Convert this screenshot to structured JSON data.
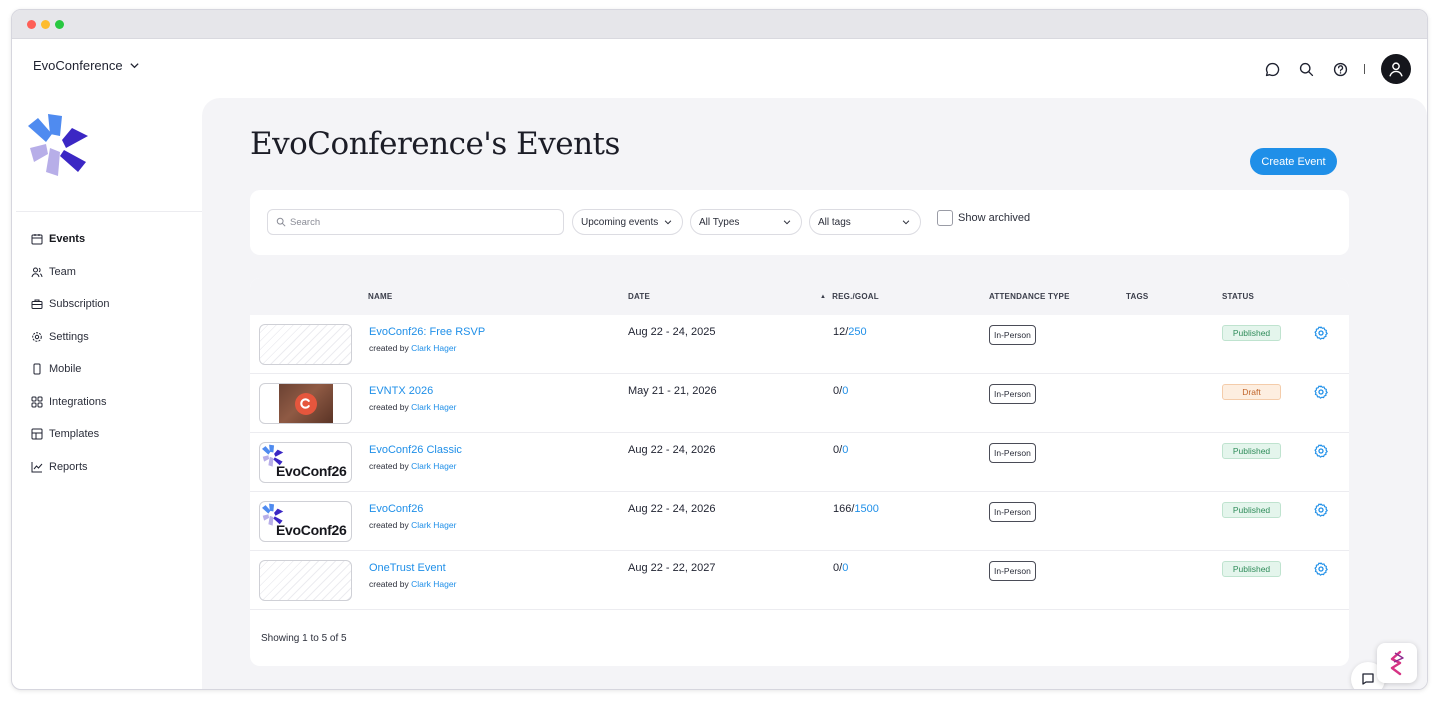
{
  "header": {
    "org_name": "EvoConference",
    "icons": [
      "chat-icon",
      "search-icon",
      "help-icon",
      "user-avatar-icon"
    ]
  },
  "sidebar": {
    "items": [
      {
        "label": "Events",
        "icon": "calendar-icon",
        "active": true
      },
      {
        "label": "Team",
        "icon": "users-icon",
        "active": false
      },
      {
        "label": "Subscription",
        "icon": "briefcase-icon",
        "active": false
      },
      {
        "label": "Settings",
        "icon": "gear-icon",
        "active": false
      },
      {
        "label": "Mobile",
        "icon": "mobile-icon",
        "active": false
      },
      {
        "label": "Integrations",
        "icon": "grid-icon",
        "active": false
      },
      {
        "label": "Templates",
        "icon": "template-icon",
        "active": false
      },
      {
        "label": "Reports",
        "icon": "chart-icon",
        "active": false
      }
    ]
  },
  "main": {
    "title": "EvoConference's Events",
    "create_label": "Create Event"
  },
  "filters": {
    "search_placeholder": "Search",
    "upcoming": "Upcoming events",
    "types": "All Types",
    "tags": "All tags",
    "show_archived": "Show archived"
  },
  "table": {
    "columns": {
      "name": "NAME",
      "date": "DATE",
      "reg": "REG./GOAL",
      "attendance": "ATTENDANCE TYPE",
      "tags": "TAGS",
      "status": "STATUS"
    },
    "rows": [
      {
        "name": "EvoConf26: Free RSVP",
        "created_by": "created by",
        "creator": "Clark Hager",
        "date": "Aug 22 - 24, 2025",
        "reg": "12/",
        "goal": "250",
        "attendance": "In-Person",
        "status": "Published",
        "thumb": "pattern"
      },
      {
        "name": "EVNTX 2026",
        "created_by": "created by",
        "creator": "Clark Hager",
        "date": "May 21 - 21, 2026",
        "reg": "0/",
        "goal": "0",
        "attendance": "In-Person",
        "status": "Draft",
        "thumb": "photo"
      },
      {
        "name": "EvoConf26 Classic",
        "created_by": "created by",
        "creator": "Clark Hager",
        "date": "Aug 22 - 24, 2026",
        "reg": "0/",
        "goal": "0",
        "attendance": "In-Person",
        "status": "Published",
        "thumb": "brand",
        "thumb_text": "EvoConf26"
      },
      {
        "name": "EvoConf26",
        "created_by": "created by",
        "creator": "Clark Hager",
        "date": "Aug 22 - 24, 2026",
        "reg": "166/",
        "goal": "1500",
        "attendance": "In-Person",
        "status": "Published",
        "thumb": "brand",
        "thumb_text": "EvoConf26"
      },
      {
        "name": "OneTrust Event",
        "created_by": "created by",
        "creator": "Clark Hager",
        "date": "Aug 22 - 22, 2027",
        "reg": "0/",
        "goal": "0",
        "attendance": "In-Person",
        "status": "Published",
        "thumb": "pattern"
      }
    ],
    "footer": "Showing 1 to 5 of 5"
  },
  "colors": {
    "accent": "#1f8fe8",
    "published": "#2f8c5a",
    "draft": "#c0642a",
    "logo_dark": "#3b27c4",
    "logo_blue": "#4f8bf0",
    "logo_light": "#b7aee8"
  }
}
